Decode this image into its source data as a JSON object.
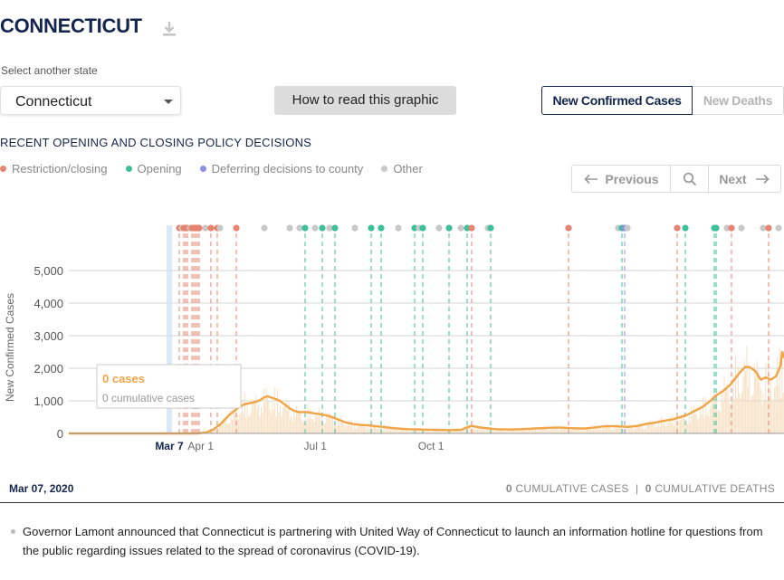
{
  "header": {
    "title": "CONNECTICUT",
    "download_icon": "download-icon"
  },
  "state_select": {
    "label": "Select another state",
    "value": "Connecticut"
  },
  "how_to_read": "How to read this graphic",
  "metric_toggle": {
    "active": "New Confirmed Cases",
    "inactive": "New Deaths"
  },
  "policy": {
    "title": "RECENT OPENING AND CLOSING POLICY DECISIONS",
    "legend": [
      {
        "label": "Restriction/closing",
        "color": "#e8836f"
      },
      {
        "label": "Opening",
        "color": "#3dbf9a"
      },
      {
        "label": "Deferring decisions to county",
        "color": "#8c8fe6"
      },
      {
        "label": "Other",
        "color": "#c8c8c8"
      }
    ]
  },
  "nav": {
    "previous": "Previous",
    "next": "Next"
  },
  "tooltip": {
    "cases": "0 cases",
    "cumulative": "0 cumulative cases"
  },
  "chart_data": {
    "type": "line",
    "ylabel": "New Confirmed Cases",
    "ylim": [
      0,
      5000
    ],
    "yticks": [
      "0",
      "1,000",
      "2,000",
      "3,000",
      "4,000",
      "5,000"
    ],
    "xticks": [
      "Mar 7",
      "Apr 1",
      "Jul 1",
      "Oct 1"
    ],
    "selected_date": "Mar 7",
    "series": [
      {
        "values": [
          [
            0,
            0
          ],
          [
            22,
            0
          ],
          [
            24,
            5
          ],
          [
            30,
            40
          ],
          [
            35,
            120
          ],
          [
            40,
            260
          ],
          [
            44,
            420
          ],
          [
            48,
            580
          ],
          [
            52,
            700
          ],
          [
            56,
            820
          ],
          [
            60,
            900
          ],
          [
            64,
            930
          ],
          [
            68,
            960
          ],
          [
            72,
            1020
          ],
          [
            75,
            1100
          ],
          [
            78,
            1140
          ],
          [
            81,
            1100
          ],
          [
            85,
            1050
          ],
          [
            88,
            1000
          ],
          [
            92,
            880
          ],
          [
            96,
            760
          ],
          [
            100,
            680
          ],
          [
            104,
            650
          ],
          [
            108,
            660
          ],
          [
            112,
            640
          ],
          [
            116,
            610
          ],
          [
            120,
            590
          ],
          [
            124,
            560
          ],
          [
            128,
            520
          ],
          [
            132,
            460
          ],
          [
            136,
            400
          ],
          [
            140,
            340
          ],
          [
            146,
            290
          ],
          [
            152,
            260
          ],
          [
            158,
            250
          ],
          [
            164,
            220
          ],
          [
            170,
            200
          ],
          [
            176,
            170
          ],
          [
            182,
            150
          ],
          [
            190,
            130
          ],
          [
            200,
            120
          ],
          [
            212,
            110
          ],
          [
            222,
            100
          ],
          [
            232,
            110
          ],
          [
            236,
            180
          ],
          [
            240,
            230
          ],
          [
            246,
            190
          ],
          [
            252,
            160
          ],
          [
            260,
            130
          ],
          [
            270,
            120
          ],
          [
            280,
            130
          ],
          [
            290,
            150
          ],
          [
            300,
            170
          ],
          [
            310,
            180
          ],
          [
            320,
            160
          ],
          [
            330,
            150
          ],
          [
            340,
            190
          ],
          [
            346,
            220
          ],
          [
            356,
            220
          ],
          [
            364,
            200
          ],
          [
            372,
            230
          ],
          [
            380,
            300
          ],
          [
            386,
            330
          ],
          [
            392,
            380
          ],
          [
            400,
            430
          ],
          [
            406,
            500
          ],
          [
            412,
            580
          ],
          [
            418,
            700
          ],
          [
            424,
            820
          ],
          [
            430,
            1000
          ],
          [
            434,
            1150
          ],
          [
            440,
            1300
          ],
          [
            446,
            1500
          ],
          [
            450,
            1700
          ],
          [
            454,
            1900
          ],
          [
            458,
            2050
          ],
          [
            462,
            2020
          ],
          [
            466,
            1900
          ],
          [
            470,
            1650
          ],
          [
            474,
            1720
          ],
          [
            478,
            1650
          ],
          [
            482,
            1750
          ],
          [
            486,
            2100
          ],
          [
            487,
            2500
          ],
          [
            489,
            2300
          ]
        ]
      }
    ],
    "policy_events": [
      "restriction",
      "other",
      "restriction",
      "restriction",
      "restriction",
      "other",
      "restriction",
      "restriction",
      "restriction",
      "restriction",
      "restriction",
      "other",
      "restriction",
      "restriction",
      "other",
      "restriction",
      "other",
      "other",
      "other",
      "opening",
      "other",
      "opening",
      "other",
      "opening",
      "other",
      "opening",
      "opening",
      "other",
      "opening",
      "other",
      "opening",
      "other",
      "opening",
      "other",
      "opening",
      "restriction",
      "other",
      "opening",
      "restriction",
      "other",
      "opening",
      "deferring",
      "other",
      "restriction",
      "opening",
      "opening",
      "opening",
      "other",
      "restriction",
      "other",
      "other",
      "restriction",
      "other"
    ]
  },
  "footer": {
    "date": "Mar 07, 2020",
    "cases_value": "0",
    "cases_label": "CUMULATIVE CASES",
    "separator": "|",
    "deaths_value": "0",
    "deaths_label": "CUMULATIVE DEATHS"
  },
  "note": "Governor Lamont announced that Connecticut is partnering with United Way of Connecticut to launch an information hotline for questions from the public regarding issues related to the spread of coronavirus (COVID-19)."
}
